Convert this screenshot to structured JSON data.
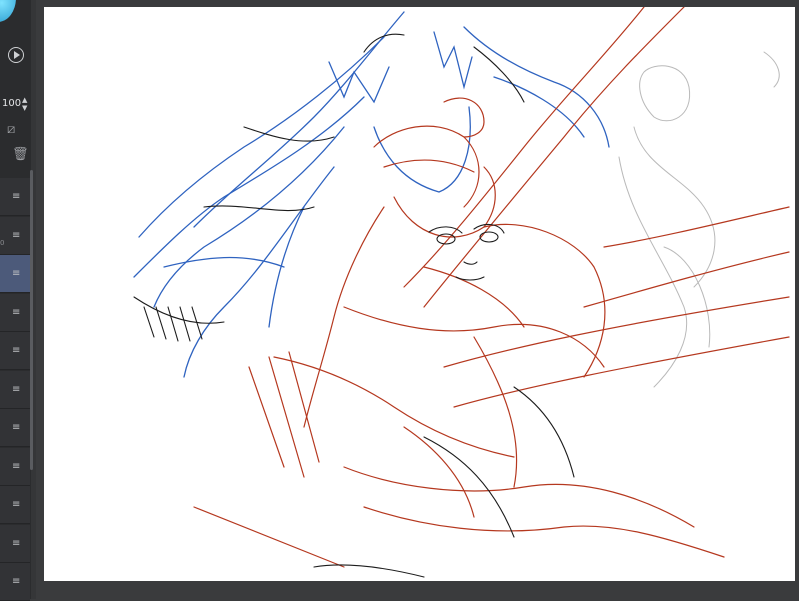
{
  "tool_panel": {
    "opacity_value": "100",
    "opacity_stepper_icon": "up-down-chevron-icon",
    "play_icon": "play-circle-icon",
    "mask_icon": "layer-mask-icon",
    "delete_icon": "trash-icon"
  },
  "layers": {
    "row_count": 11,
    "selected_index": 2,
    "row_handle_icon": "drag-handle-icon",
    "items": [
      {
        "handle": "≡"
      },
      {
        "handle": "≡",
        "tick": "0"
      },
      {
        "handle": "≡"
      },
      {
        "handle": "≡"
      },
      {
        "handle": "≡"
      },
      {
        "handle": "≡"
      },
      {
        "handle": "≡"
      },
      {
        "handle": "≡"
      },
      {
        "handle": "≡"
      },
      {
        "handle": "≡"
      },
      {
        "handle": "≡"
      }
    ]
  },
  "canvas": {
    "background": "#ffffff",
    "stroke_colors": {
      "red": "#b5381f",
      "blue": "#2f63c0",
      "black": "#1c1c1c",
      "gray": "#9a9a9a"
    }
  }
}
